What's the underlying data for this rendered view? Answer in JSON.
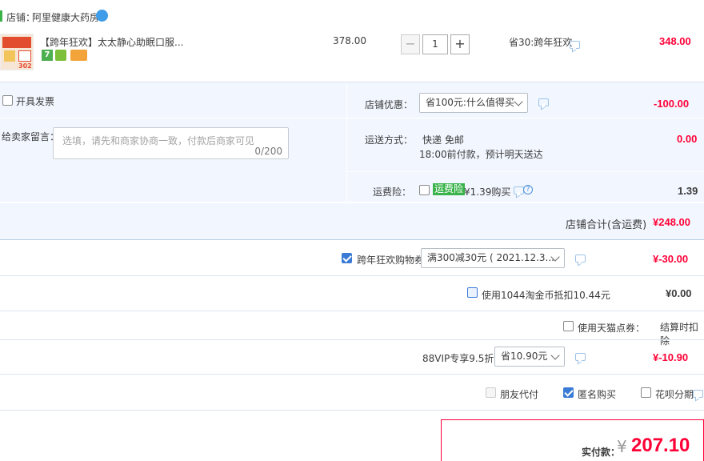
{
  "shop": {
    "label": "店铺：",
    "name": "阿里健康大药房"
  },
  "item": {
    "title": "【跨年狂欢】太太静心助眠口服...",
    "price": "378.00",
    "qty": "1",
    "promo": "省30:跨年狂欢",
    "subtotal": "348.00",
    "thumb_text": "302",
    "badge_seven": "7"
  },
  "invoice": {
    "label": "开具发票"
  },
  "shop_discount": {
    "label": "店铺优惠：",
    "selected": "省100元:什么值得买",
    "amount": "-100.00"
  },
  "message": {
    "label": "给卖家留言：",
    "placeholder": "选填，请先和商家协商一致，付款后商家可见",
    "counter": "0/200"
  },
  "shipping": {
    "label": "运送方式：",
    "method": "快递 免邮",
    "note": "18:00前付款，预计明天送达",
    "amount": "0.00"
  },
  "insurance": {
    "label": "运费险：",
    "tag": "运费险",
    "desc": "¥1.39购买",
    "amount": "1.39"
  },
  "shop_total": {
    "label": "店铺合计(含运费)",
    "amount": "¥248.00"
  },
  "coupon": {
    "label": "跨年狂欢购物券",
    "selected": "满300减30元 ( 2021.12.3...",
    "amount": "¥-30.00"
  },
  "taojinbi": {
    "label": "使用1044淘金币抵扣10.44元",
    "amount": "¥0.00"
  },
  "tmall_points": {
    "label": "使用天猫点券：",
    "value": "结算时扣除"
  },
  "vip": {
    "label": "88VIP专享9.5折",
    "selected": "省10.90元",
    "amount": "¥-10.90"
  },
  "options": {
    "friend_pay": "朋友代付",
    "anonymous": "匿名购买",
    "huabei": "花呗分期"
  },
  "payment": {
    "label": "实付款：",
    "currency": "¥",
    "amount": "207.10"
  },
  "colors": {
    "accent": "#ff0036",
    "panel": "#f2f7ff",
    "check": "#3a7bd5"
  }
}
